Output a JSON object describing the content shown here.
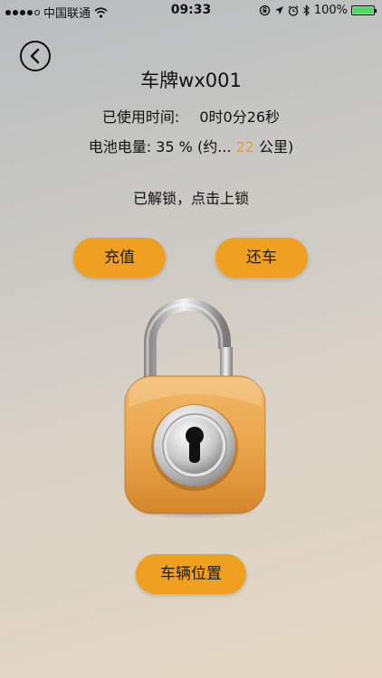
{
  "status_bar": {
    "carrier": "中国联通",
    "time": "09:33",
    "battery_percent": "100%",
    "battery_level": 1.0,
    "signal_bars": 4,
    "icons": [
      "signal-dots-icon",
      "wifi-icon",
      "rotation-lock-icon",
      "location-arrow-icon",
      "alarm-icon",
      "bluetooth-icon",
      "battery-icon"
    ]
  },
  "header": {
    "back_icon": "chevron-left-icon",
    "title": "车牌wx001"
  },
  "usage": {
    "label": "已使用时间:",
    "value": "0时0分26秒"
  },
  "battery_info": {
    "label": "电池电量:",
    "percent": "35",
    "percent_unit": "%",
    "approx_prefix": "(约...",
    "range": "22",
    "range_unit": "公里)"
  },
  "lock_status": "已解锁，点击上锁",
  "lock": {
    "icon": "padlock-open-icon",
    "state": "unlocked"
  },
  "buttons": {
    "recharge": "充值",
    "return_car": "还车",
    "vehicle_location": "车辆位置"
  },
  "colors": {
    "accent": "#f0a020",
    "range_highlight": "#f0a020",
    "battery_fill": "#4cd964"
  }
}
